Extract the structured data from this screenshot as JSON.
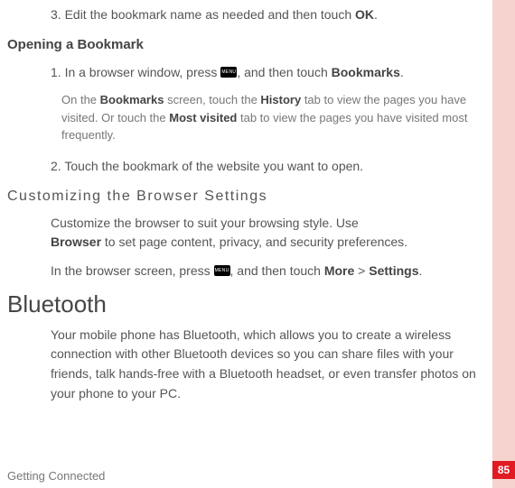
{
  "step3_prefix": "3. Edit the bookmark name as needed and then touch ",
  "step3_bold": "OK",
  "step3_suffix": ".",
  "heading_open": "Opening a Bookmark",
  "open_s1_prefix": "1. In a browser window, press ",
  "menu_label": "MENU",
  "open_s1_mid": ", and then touch ",
  "open_s1_bold": "Bookmarks",
  "open_s1_suffix": ".",
  "open_s1_sub_a": "On the ",
  "open_s1_sub_b1": "Bookmarks",
  "open_s1_sub_c": " screen, touch the ",
  "open_s1_sub_b2": "History",
  "open_s1_sub_d": " tab to view the pages you have visited. Or touch the ",
  "open_s1_sub_b3": "Most visited",
  "open_s1_sub_e": " tab to view the pages you have visited most frequently.",
  "open_s2": "2. Touch the bookmark of the website you want to open.",
  "heading_custom": "Customizing  the  Browser  Settings",
  "custom_p1_a": "Customize the browser to suit your browsing style. Use ",
  "custom_p1_b": "Browser",
  "custom_p1_c": " to set page content, privacy, and security preferences.",
  "custom_p2_a": "In the browser screen, press ",
  "custom_p2_b": ", and then touch ",
  "custom_p2_more": "More",
  "custom_p2_gt": " > ",
  "custom_p2_settings": "Settings",
  "custom_p2_end": ".",
  "heading_bt": "Bluetooth",
  "bt_body": "Your mobile phone has Bluetooth, which allows you to create a wireless connection with other Bluetooth devices so you can share files with your friends, talk hands-free with a Bluetooth headset, or even transfer photos on your phone to your PC.",
  "footer": "Getting Connected",
  "page_num": "85"
}
